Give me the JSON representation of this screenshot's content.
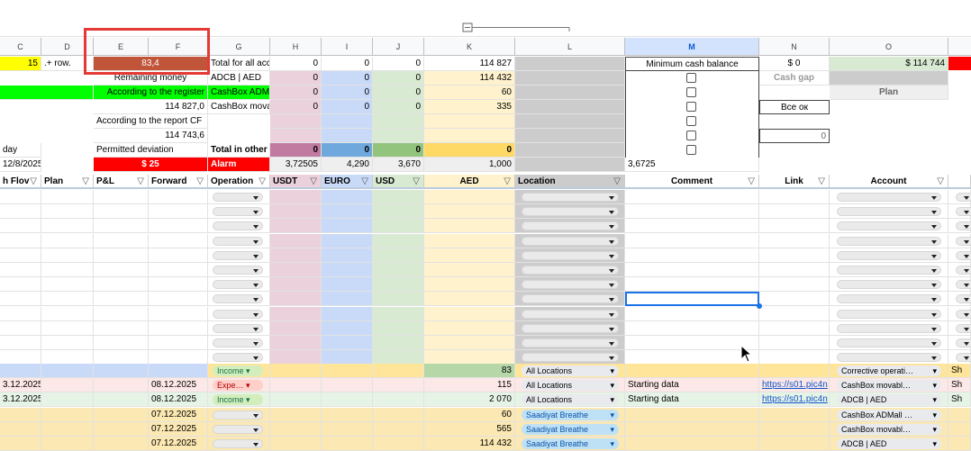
{
  "columns": [
    "C",
    "D",
    "E",
    "F",
    "G",
    "H",
    "I",
    "J",
    "K",
    "L",
    "M",
    "N",
    "O"
  ],
  "summary": {
    "c1": "15",
    "d1": ".+ row.",
    "ef1": "83,4",
    "g1": "Total for all acc",
    "h1": "0",
    "i1": "0",
    "j1": "0",
    "k1": "114 827",
    "m1": "Minimum cash balance",
    "n1": "$ 0",
    "o1": "$ 114 744",
    "ef2": "Remaining money",
    "g2": "ADCB  | AED",
    "h2": "0",
    "i2": "0",
    "j2": "0",
    "k2": "114 432",
    "n2": "Cash gap",
    "ef3": "According to the register",
    "g3": "CashBox ADM",
    "h3": "0",
    "i3": "0",
    "j3": "0",
    "k3": "60",
    "o3": "Plan",
    "ef4": "114 827,0",
    "g4": "CashBox mova",
    "h4": "0",
    "i4": "0",
    "j4": "0",
    "k4": "335",
    "n4": "Все ок",
    "ef5": "According to the report CF",
    "ef6": "114 743,6",
    "n6": "0",
    "c7": "day",
    "ef7": "Permitted deviation",
    "g7": "Total in other",
    "h7": "0",
    "i7": "0",
    "j7": "0",
    "k7": "0",
    "c8": "12/8/2025",
    "ef8": "$ 25",
    "g8": "Alarm",
    "h8": "3,72505",
    "i8": "4,290",
    "j8": "3,670",
    "k8": "1,000",
    "m8": "3,6725"
  },
  "headers": {
    "cashflow": "h Flov",
    "plan": "Plan",
    "pl": "P&L",
    "forward": "Forward",
    "operation": "Operation",
    "usdt": "USDT",
    "euro": "EURO",
    "usd": "USD",
    "aed": "AED",
    "location": "Location",
    "comment": "Comment",
    "link": "Link",
    "account": "Account"
  },
  "rows": [
    {
      "date": "",
      "fwd": "",
      "op": "Income",
      "aed": "83",
      "loc": "All Locations",
      "comment": "",
      "link": "",
      "acct": "Corrective operati…",
      "extra": "Sh"
    },
    {
      "date": "3.12.2025",
      "fwd": "08.12.2025",
      "op": "Expe…",
      "aed": "115",
      "loc": "All Locations",
      "comment": "Starting data",
      "link": "https://s01.pic4n",
      "acct": "CashBox movabl…",
      "extra": "Sh"
    },
    {
      "date": "3.12.2025",
      "fwd": "08.12.2025",
      "op": "Income",
      "aed": "2 070",
      "loc": "All Locations",
      "comment": "Starting data",
      "link": "https://s01.pic4n",
      "acct": "ADCB | AED",
      "extra": "Sh"
    },
    {
      "date": "",
      "fwd": "07.12.2025",
      "op": "",
      "aed": "60",
      "loc": "Saadiyat Breathe",
      "comment": "",
      "link": "",
      "acct": "CashBox ADMall …",
      "extra": ""
    },
    {
      "date": "",
      "fwd": "07.12.2025",
      "op": "",
      "aed": "565",
      "loc": "Saadiyat Breathe",
      "comment": "",
      "link": "",
      "acct": "CashBox movabl…",
      "extra": ""
    },
    {
      "date": "",
      "fwd": "07.12.2025",
      "op": "",
      "aed": "114 432",
      "loc": "Saadiyat Breathe",
      "comment": "",
      "link": "",
      "acct": "ADCB | AED",
      "extra": ""
    }
  ],
  "colors": {
    "yellow": "#ffff00",
    "green": "#00ff00",
    "red": "#ff0000",
    "brick": "#c0553a",
    "pink": "#ead1dc",
    "blue": "#c9daf8",
    "green_light": "#d9ead3",
    "cream": "#fff2cc",
    "gray": "#cccccc",
    "orange_row": "#fce8b2",
    "highlight_box": "#e53935"
  }
}
